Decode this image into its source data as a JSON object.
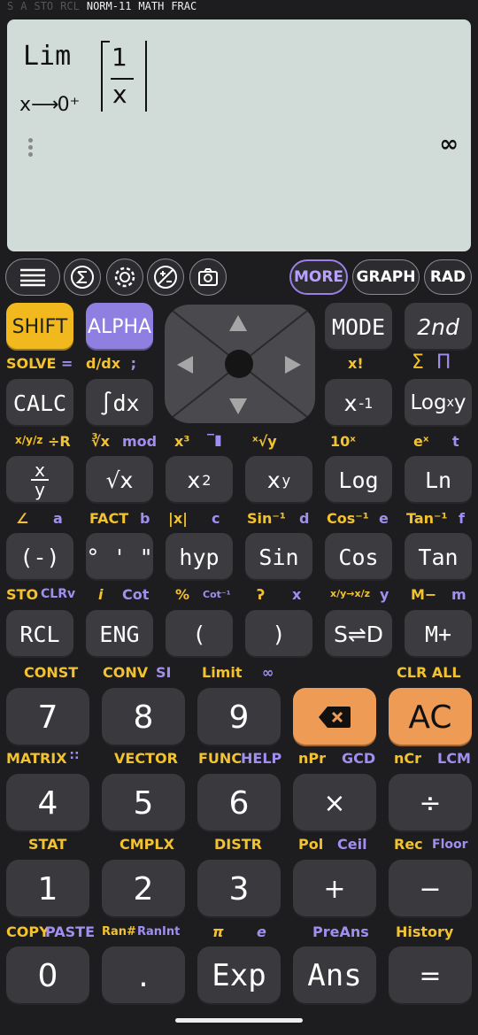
{
  "status": {
    "dim": [
      "S",
      "A",
      "STO",
      "RCL"
    ],
    "on": [
      "NORM-11",
      "MATH",
      "FRAC"
    ]
  },
  "display": {
    "lim_word": "Lim",
    "lim_sub_var": "x",
    "lim_sub_arrow": "⟶",
    "lim_sub_target": "0⁺",
    "frac_num": "1",
    "frac_den": "x",
    "result": "∞"
  },
  "toolbar": {
    "more": "MORE",
    "graph": "GRAPH",
    "rad": "RAD",
    "icons": [
      "menu-icon",
      "sigma-icon",
      "gear-icon",
      "plus-minus-icon",
      "camera-icon"
    ]
  },
  "keys": {
    "shift": "SHIFT",
    "alpha": "ALPHA",
    "mode": "MODE",
    "second": "2nd",
    "calc": "CALC",
    "int_dx": "∫dx",
    "x_inv_base": "x",
    "x_inv_exp": "-1",
    "logxy": "Log",
    "logxy_sub": "x",
    "logxy_y": "y",
    "frac_top": "x",
    "frac_bottom": "y",
    "sqrt": "√x",
    "x2_base": "x",
    "x2_exp": "2",
    "xy_base": "x",
    "xy_exp": "y",
    "log": "Log",
    "ln": "Ln",
    "neg": "(-)",
    "dms": "° ' \"",
    "hyp": "hyp",
    "sin": "Sin",
    "cos": "Cos",
    "tan": "Tan",
    "rcl": "RCL",
    "eng": "ENG",
    "lparen": "(",
    "rparen": ")",
    "sd": "S⇌D",
    "mplus": "M+",
    "n7": "7",
    "n8": "8",
    "n9": "9",
    "ac": "AC",
    "n4": "4",
    "n5": "5",
    "n6": "6",
    "mul": "×",
    "div": "÷",
    "n1": "1",
    "n2": "2",
    "n3": "3",
    "add": "+",
    "sub": "−",
    "n0": "0",
    "dot": ".",
    "exp": "Exp",
    "ans": "Ans",
    "eq": "="
  },
  "labels": {
    "solve": "SOLVE",
    "solve_eq": "=",
    "ddx": "d/dx",
    "semicolon": ";",
    "xfact": "x!",
    "sum": "Σ",
    "prod": "Π",
    "xyz": "x/y/z",
    "divR": "÷R",
    "cbrt": "∛x",
    "mod": "mod",
    "x3": "x³",
    "overline": "‾▮",
    "xroot": "ˣ√y",
    "tenx": "10ˣ",
    "ex": "eˣ",
    "t": "t",
    "angle": "∠",
    "a": "a",
    "fact": "FACT",
    "b": "b",
    "abs": "|x|",
    "c": "c",
    "sin_inv": "Sin⁻¹",
    "d": "d",
    "cos_inv": "Cos⁻¹",
    "e": "e",
    "tan_inv": "Tan⁻¹",
    "f": "f",
    "sto": "STO",
    "clrv": "CLRv",
    "i": "i",
    "cot": "Cot",
    "pct": "%",
    "cot_inv": "Cot⁻¹",
    "comma": "ʔ",
    "x": "x",
    "xy_xz": "x/y→x/z",
    "y": "y",
    "mminus": "M−",
    "m": "m",
    "const": "CONST",
    "conv": "CONV",
    "si": "SI",
    "limit": "Limit",
    "inf": "∞",
    "clrall": "CLR ALL",
    "matrix": "MATRIX",
    "vector": "VECTOR",
    "func": "FUNC",
    "help": "HELP",
    "npr": "nPr",
    "gcd": "GCD",
    "ncr": "nCr",
    "lcm": "LCM",
    "stat": "STAT",
    "cmplx": "CMPLX",
    "distr": "DISTR",
    "pol": "Pol",
    "ceil": "Ceil",
    "rec": "Rec",
    "floor": "Floor",
    "copy": "COPY",
    "paste": "PASTE",
    "rann": "Ran#",
    "ranint": "RanInt",
    "pi": "π",
    "e_const": "e",
    "preans": "PreAns",
    "history": "History"
  }
}
